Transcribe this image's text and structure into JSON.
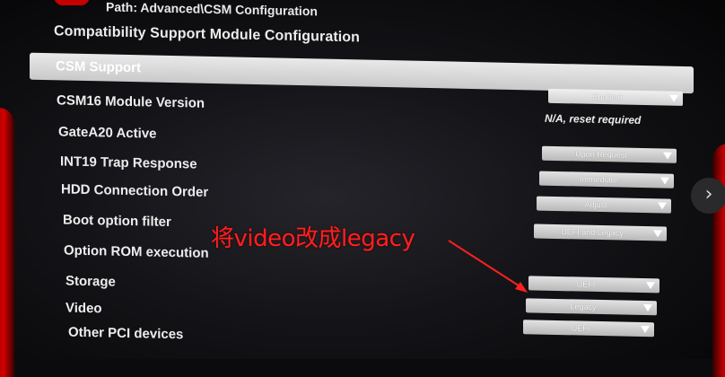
{
  "header": {
    "path": "Path: Advanced\\CSM Configuration",
    "section_title": "Compatibility Support Module Configuration"
  },
  "settings": [
    {
      "label": "CSM Support",
      "value": "Enabled",
      "control": "dropdown",
      "selected": true
    },
    {
      "label": "CSM16 Module Version",
      "value": "N/A, reset required",
      "control": "static"
    },
    {
      "label": "GateA20 Active",
      "value": "Upon Request",
      "control": "dropdown"
    },
    {
      "label": "INT19 Trap Response",
      "value": "Immediate",
      "control": "dropdown"
    },
    {
      "label": "HDD Connection Order",
      "value": "Adjust",
      "control": "dropdown"
    },
    {
      "label": "Boot option filter",
      "value": "UEFI and Legacy",
      "control": "dropdown"
    },
    {
      "label": "Option ROM execution",
      "value": "",
      "control": "header"
    },
    {
      "label": "Storage",
      "value": "UEFI",
      "control": "dropdown"
    },
    {
      "label": "Video",
      "value": "Legacy",
      "control": "dropdown"
    },
    {
      "label": "Other PCI devices",
      "value": "UEFI",
      "control": "dropdown"
    }
  ],
  "annotation": {
    "text": "将video改成legacy",
    "color": "#ff2020"
  },
  "nav": {
    "next_glyph": "›"
  },
  "colors": {
    "background": "#0b0b0d",
    "accent_red": "#c40000",
    "highlight": "#e9e9e9"
  }
}
